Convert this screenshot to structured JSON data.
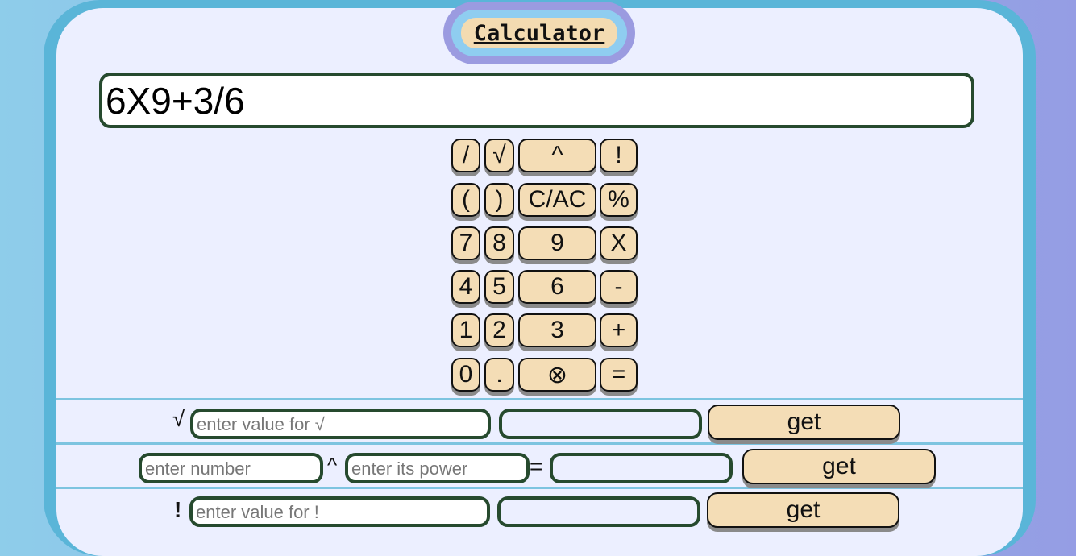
{
  "title": "Calculator",
  "display": {
    "expression": "6X9+3/6"
  },
  "keypad": {
    "keys": [
      [
        "/",
        "√",
        "^",
        "!"
      ],
      [
        "(",
        ")",
        "C/AC",
        "%"
      ],
      [
        "7",
        "8",
        "9",
        "X"
      ],
      [
        "4",
        "5",
        "6",
        "-"
      ],
      [
        "1",
        "2",
        "3",
        "+"
      ],
      [
        "0",
        ".",
        "⊗",
        "="
      ]
    ]
  },
  "sqrt_row": {
    "symbol": "√",
    "input_placeholder": "enter value for √",
    "result": "",
    "button": "get"
  },
  "power_row": {
    "number_placeholder": "enter number",
    "caret": "^",
    "power_placeholder": "enter its power",
    "equals": "=",
    "result": "",
    "button": "get"
  },
  "factorial_row": {
    "symbol": "!",
    "input_placeholder": "enter value for !",
    "result": "",
    "button": "get"
  },
  "colors": {
    "key_fill": "#f4ddb6",
    "field_border": "#264a2e",
    "frame": "#5ab5d8",
    "panel": "#ecefff"
  }
}
